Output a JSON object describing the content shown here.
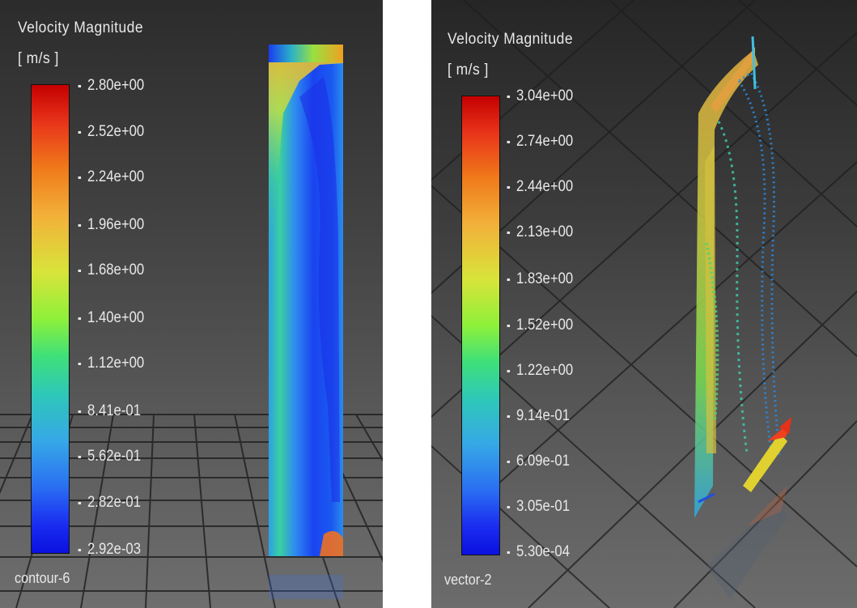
{
  "panels": [
    {
      "legend": {
        "title": "Velocity Magnitude",
        "unit": "[ m/s ]",
        "ticks": [
          "2.80e+00",
          "2.52e+00",
          "2.24e+00",
          "1.96e+00",
          "1.68e+00",
          "1.40e+00",
          "1.12e+00",
          "8.41e-01",
          "5.62e-01",
          "2.82e-01",
          "2.92e-03"
        ]
      },
      "object_name": "contour-6"
    },
    {
      "legend": {
        "title": "Velocity Magnitude",
        "unit": "[ m/s ]",
        "ticks": [
          "3.04e+00",
          "2.74e+00",
          "2.44e+00",
          "2.13e+00",
          "1.83e+00",
          "1.52e+00",
          "1.22e+00",
          "9.14e-01",
          "6.09e-01",
          "3.05e-01",
          "5.30e-04"
        ]
      },
      "object_name": "vector-2"
    }
  ],
  "colors": {
    "scale_max": "#c40000",
    "scale_min": "#0a10e0",
    "background_top": "#2c2c2c",
    "background_bottom": "#6e6e6e"
  }
}
